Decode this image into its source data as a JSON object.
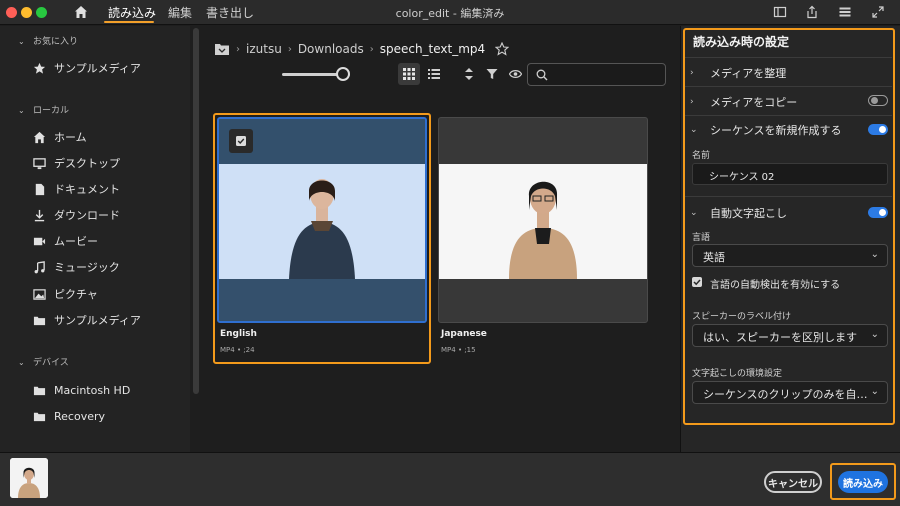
{
  "titlebar": {
    "tabs": [
      "読み込み",
      "編集",
      "書き出し"
    ],
    "active_tab": "読み込み",
    "title": "color_edit - 編集済み"
  },
  "sidebar": {
    "favorites_header": "お気に入り",
    "favorites": [
      {
        "icon": "star-icon",
        "label": "サンプルメディア"
      }
    ],
    "local_header": "ローカル",
    "local": [
      {
        "icon": "home-icon",
        "label": "ホーム"
      },
      {
        "icon": "desktop-icon",
        "label": "デスクトップ"
      },
      {
        "icon": "document-icon",
        "label": "ドキュメント"
      },
      {
        "icon": "download-icon",
        "label": "ダウンロード"
      },
      {
        "icon": "movie-icon",
        "label": "ムービー"
      },
      {
        "icon": "music-icon",
        "label": "ミュージック"
      },
      {
        "icon": "picture-icon",
        "label": "ピクチャ"
      },
      {
        "icon": "folder-icon",
        "label": "サンプルメディア"
      }
    ],
    "devices_header": "デバイス",
    "devices": [
      {
        "icon": "folder-icon",
        "label": "Macintosh HD"
      },
      {
        "icon": "folder-icon",
        "label": "Recovery"
      }
    ]
  },
  "breadcrumb": [
    "izutsu",
    "Downloads",
    "speech_text_mp4"
  ],
  "media": [
    {
      "title": "English",
      "meta": "MP4 • ;24",
      "selected": true
    },
    {
      "title": "Japanese",
      "meta": "MP4 • ;15",
      "selected": false
    }
  ],
  "panel": {
    "title": "読み込み時の設定",
    "organize": "メディアを整理",
    "copy": "メディアをコピー",
    "new_sequence": "シーケンスを新規作成する",
    "name_label": "名前",
    "name_value": "シーケンス 02",
    "auto_transcribe": "自動文字起こし",
    "language_label": "言語",
    "language_value": "英語",
    "auto_detect": "言語の自動検出を有効にする",
    "speaker_label": "スピーカーのラベル付け",
    "speaker_value": "はい、スピーカーを区別します",
    "env_label": "文字起こしの環境設定",
    "env_value": "シーケンスのクリップのみを自…"
  },
  "buttons": {
    "cancel": "キャンセル",
    "import": "読み込み"
  },
  "colors": {
    "accent": "#f39a1b",
    "primary": "#1f73e0",
    "toggle_on": "#2c7be5"
  }
}
